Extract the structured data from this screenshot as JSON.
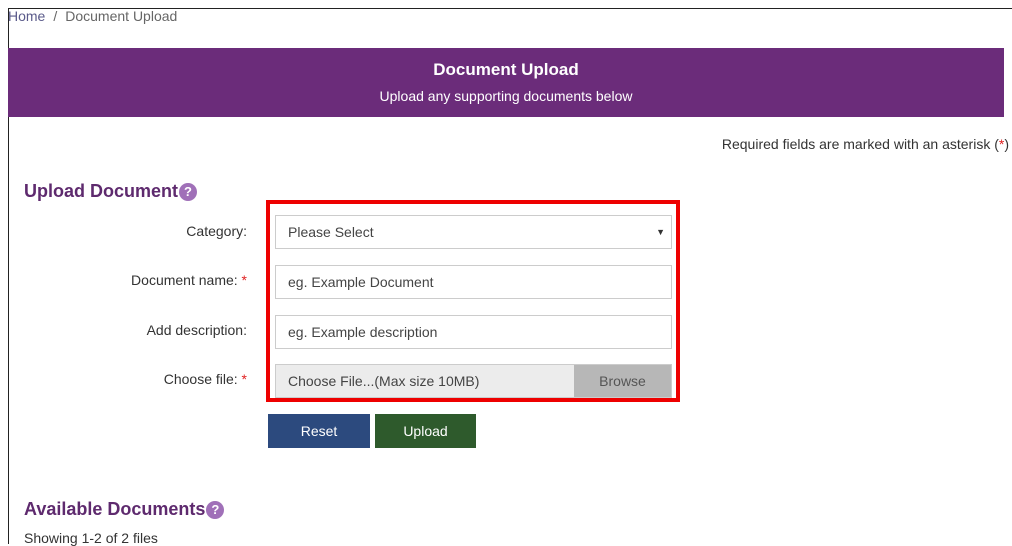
{
  "breadcrumb": {
    "home": "Home",
    "separator": "/",
    "current": "Document Upload"
  },
  "banner": {
    "title": "Document Upload",
    "subtitle": "Upload any supporting documents below",
    "color": "#6b2c7a"
  },
  "required_note": {
    "text": "Required fields are marked with an asterisk (",
    "star": "*",
    "close": ")"
  },
  "upload_section": {
    "heading": "Upload Document",
    "help": "?",
    "fields": {
      "category": {
        "label": "Category:",
        "value": "Please Select"
      },
      "document_name": {
        "label": "Document name:",
        "required": "*",
        "placeholder": "eg. Example Document"
      },
      "description": {
        "label": "Add description:",
        "placeholder": "eg. Example description"
      },
      "file": {
        "label": "Choose file:",
        "required": "*",
        "placeholder": "Choose File...(Max size 10MB)",
        "browse": "Browse"
      }
    },
    "buttons": {
      "reset": "Reset",
      "upload": "Upload"
    }
  },
  "available_section": {
    "heading": "Available Documents",
    "help": "?",
    "showing": "Showing 1-2 of 2 files"
  }
}
